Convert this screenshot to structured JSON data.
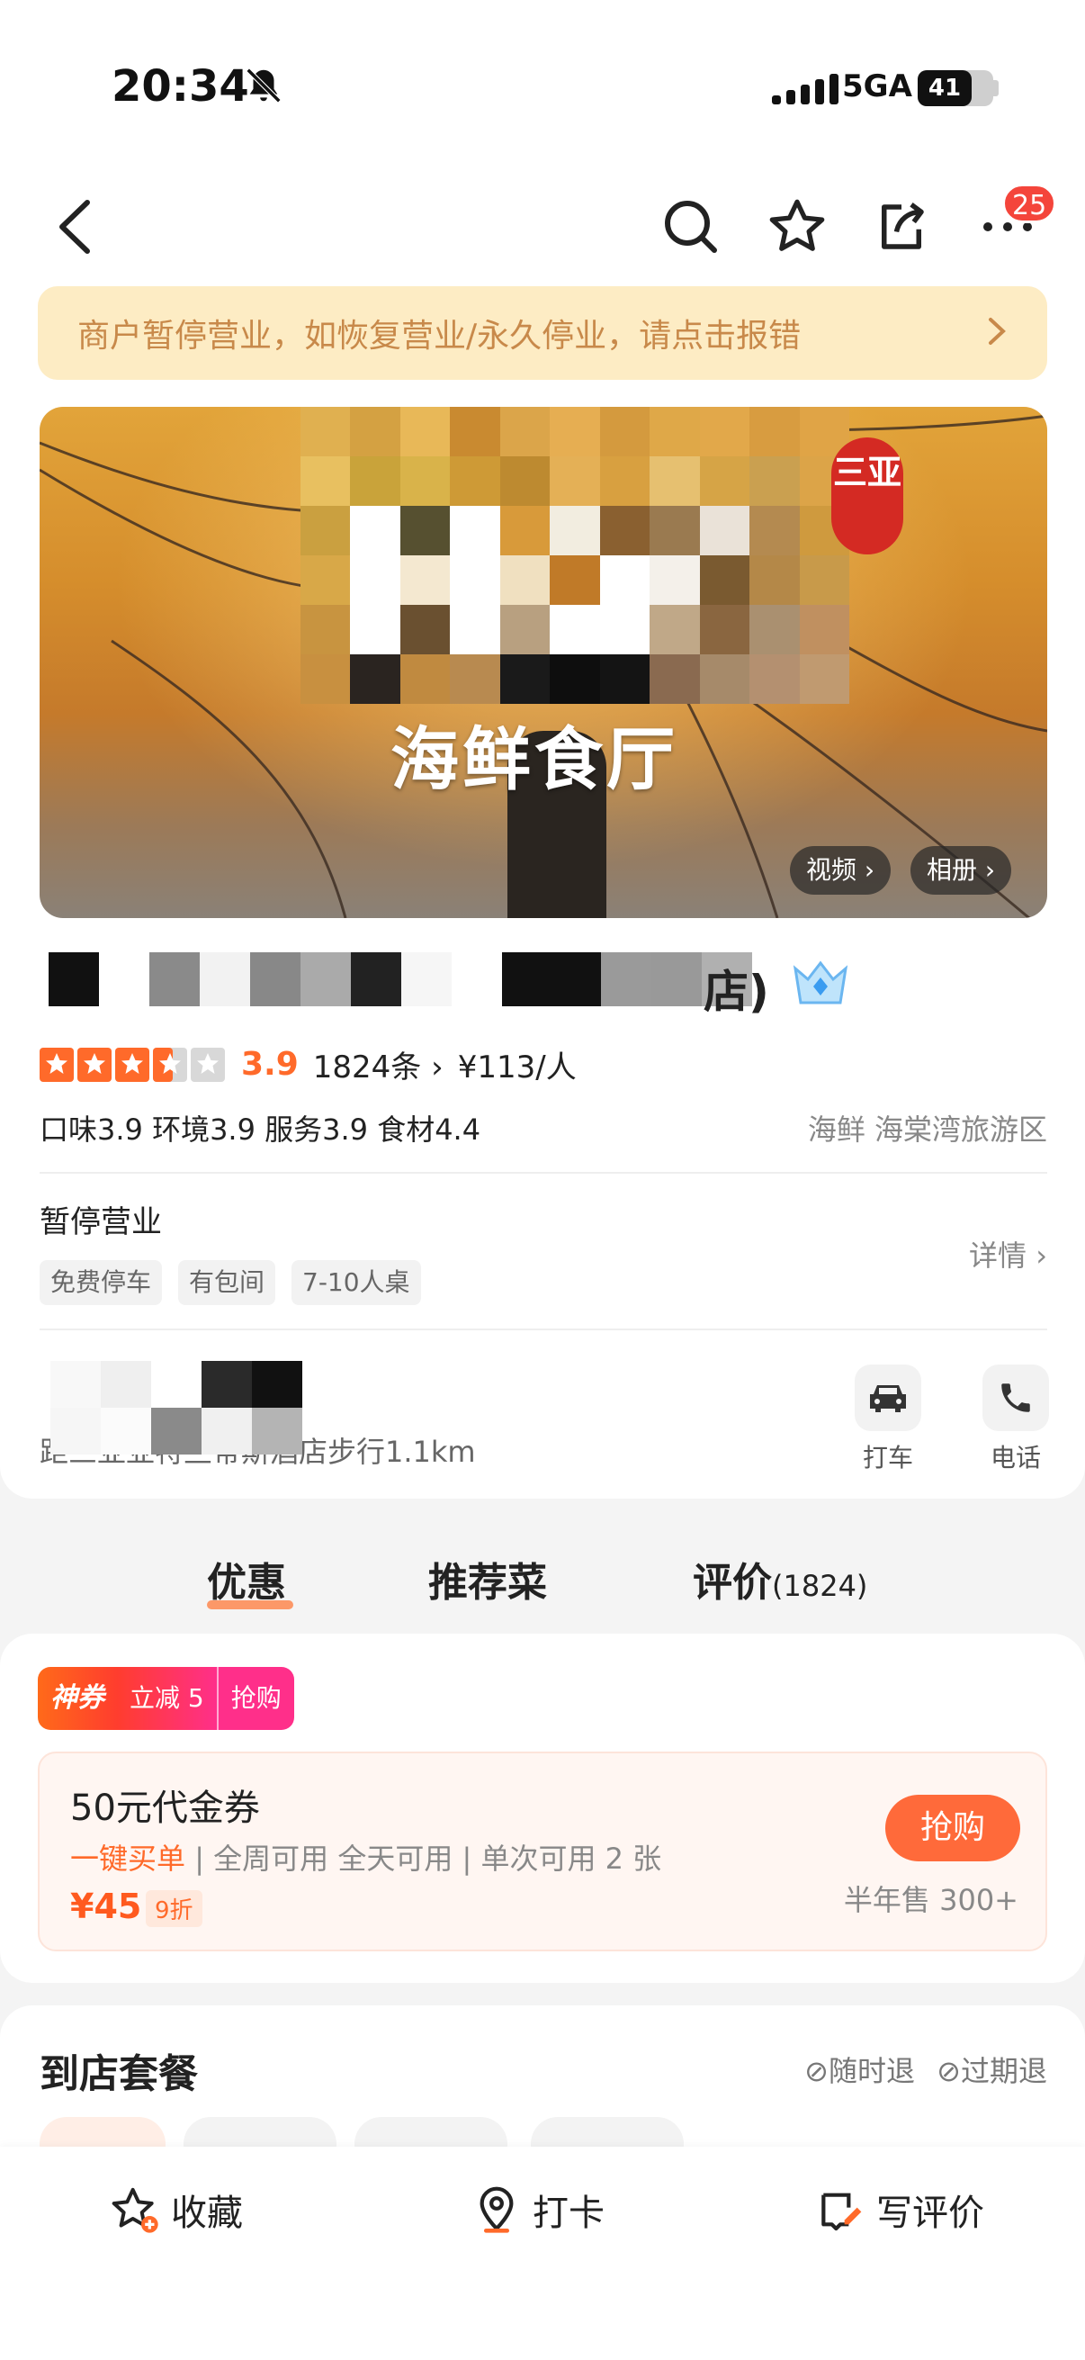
{
  "status_bar": {
    "time": "20:34",
    "network": "5GA",
    "battery": "41"
  },
  "nav": {
    "more_badge": "25"
  },
  "notice": {
    "text": "商户暂停营业，如恢复营业/永久停业，请点击报错"
  },
  "hero": {
    "caption": "海鲜食厅",
    "stamp": "三亚",
    "video_label": "视频",
    "album_label": "相册"
  },
  "store": {
    "name_suffix": "店)",
    "score": "3.9",
    "review_count": "1824条",
    "price_per_person": "¥113/人",
    "sub_scores": "口味3.9  环境3.9  服务3.9  食材4.4",
    "category": "海鲜  海棠湾旅游区",
    "status": "暂停营业",
    "tags": [
      "免费停车",
      "有包间",
      "7-10人桌"
    ],
    "detail_label": "详情",
    "address_hint": "距三亚亚特兰蒂斯酒店步行1.1km",
    "actions": {
      "taxi": "打车",
      "phone": "电话"
    }
  },
  "tabs": {
    "deals": "优惠",
    "dishes": "推荐菜",
    "reviews": "评价",
    "review_count": "(1824)"
  },
  "coupon": {
    "tag_brand": "神券",
    "tag_reduce": "立减 5",
    "tag_grab": "抢购",
    "title": "50元代金券",
    "one_click": "一键买单",
    "usage": "全周可用  全天可用",
    "limit": "单次可用 2 张",
    "price": "¥45",
    "discount": "9折",
    "buy_label": "抢购",
    "sold": "半年售 300+"
  },
  "package": {
    "title": "到店套餐",
    "refund_anytime": "随时退",
    "refund_expired": "过期退"
  },
  "bottom_bar": {
    "favorite": "收藏",
    "checkin": "打卡",
    "write_review": "写评价"
  },
  "colors": {
    "accent": "#ff6a2a",
    "notice_bg": "#fdecc4",
    "badge": "#f4453b"
  }
}
